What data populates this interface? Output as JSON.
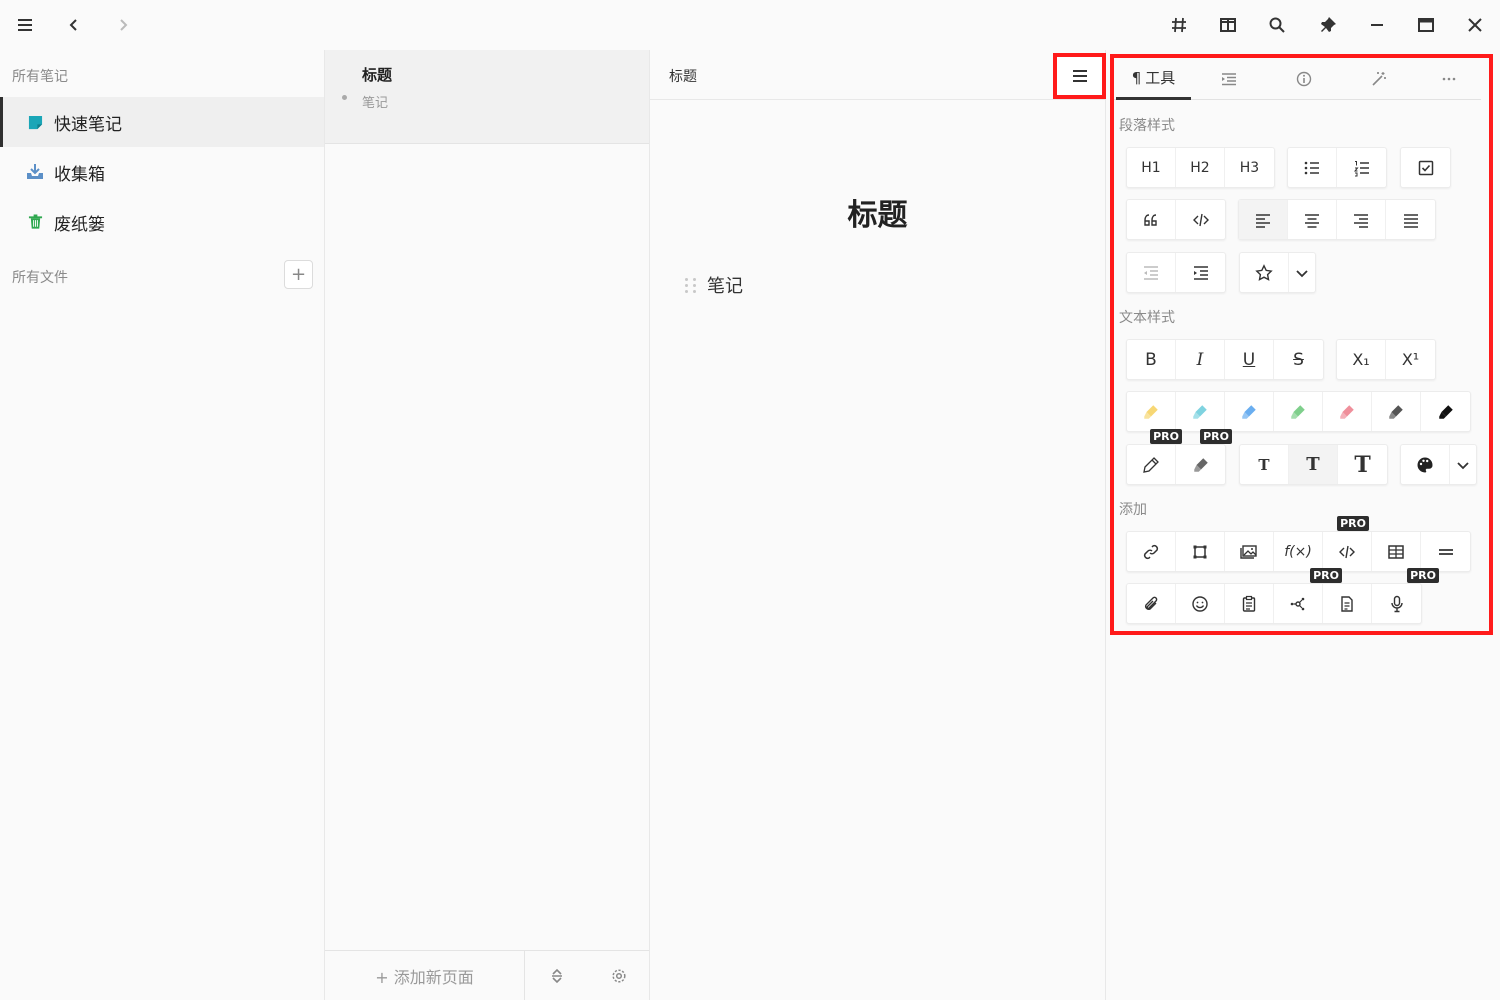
{
  "titlebar": {
    "left": [
      "menu-icon",
      "back-icon",
      "forward-icon"
    ],
    "right": [
      "hash-icon",
      "split-view-icon",
      "search-icon",
      "pin-icon",
      "minimize-icon",
      "maximize-icon",
      "close-icon"
    ]
  },
  "sidebar": {
    "all_notes_label": "所有笔记",
    "items": [
      {
        "label": "快速笔记",
        "icon": "sticky-note-icon",
        "color": "#1aa6b7"
      },
      {
        "label": "收集箱",
        "icon": "inbox-icon",
        "color": "#5b8fc7"
      },
      {
        "label": "废纸篓",
        "icon": "trash-icon",
        "color": "#2fa84f"
      }
    ],
    "all_files_label": "所有文件",
    "add_folder": "+"
  },
  "notelist": {
    "note": {
      "title": "标题",
      "preview": "笔记"
    },
    "add_page": "+ 添加新页面"
  },
  "editor": {
    "breadcrumb": "标题",
    "title": "标题",
    "line": "笔记"
  },
  "panel": {
    "tabs": [
      {
        "label": "工具",
        "icon": "pilcrow-icon"
      },
      {
        "icon": "outline-icon"
      },
      {
        "icon": "info-icon"
      },
      {
        "icon": "magic-wand-icon"
      },
      {
        "icon": "more-icon"
      }
    ],
    "paragraph_label": "段落样式",
    "text_label": "文本样式",
    "add_label": "添加",
    "headings": [
      "H1",
      "H2",
      "H3"
    ],
    "text_buttons": [
      "B",
      "I",
      "U",
      "S",
      "X₁",
      "X¹"
    ],
    "pro_badge": "PRO",
    "highlight_colors": [
      "#f7d774",
      "#7fd3e0",
      "#6aaef0",
      "#7fcf8c",
      "#ef8f9b",
      "#555555",
      "#111111"
    ]
  }
}
